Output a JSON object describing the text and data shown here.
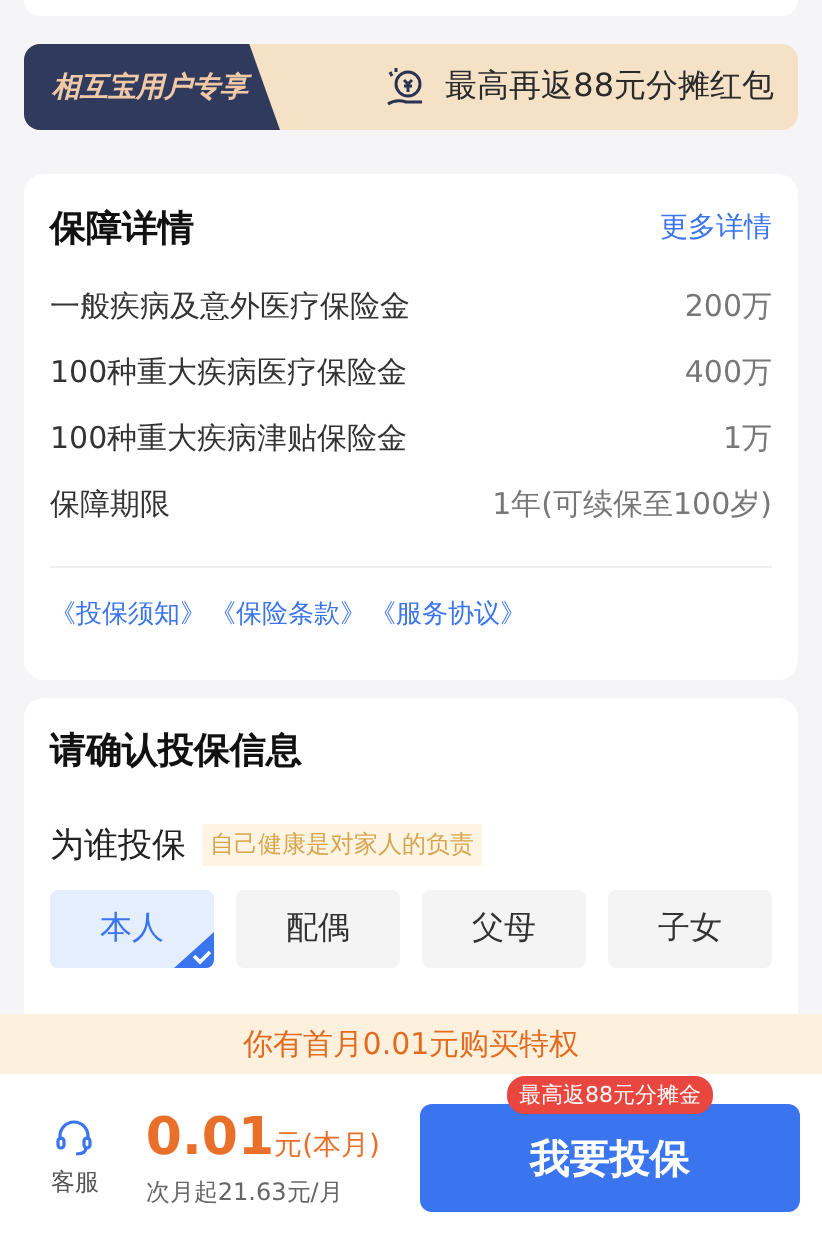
{
  "banner": {
    "tag": "相互宝用户专享",
    "text": "最高再返88元分摊红包"
  },
  "coverage": {
    "title": "保障详情",
    "more": "更多详情",
    "rows": [
      {
        "label": "一般疾病及意外医疗保险金",
        "value": "200万"
      },
      {
        "label": "100种重大疾病医疗保险金",
        "value": "400万"
      },
      {
        "label": "100种重大疾病津贴保险金",
        "value": "1万"
      },
      {
        "label": "保障期限",
        "value": "1年(可续保至100岁)"
      }
    ],
    "links": [
      "《投保须知》",
      "《保险条款》",
      "《服务协议》"
    ]
  },
  "insured": {
    "title": "请确认投保信息",
    "question": "为谁投保",
    "hint": "自己健康是对家人的负责",
    "options": [
      {
        "label": "本人",
        "selected": true
      },
      {
        "label": "配偶",
        "selected": false
      },
      {
        "label": "父母",
        "selected": false
      },
      {
        "label": "子女",
        "selected": false
      }
    ]
  },
  "promo": "你有首月0.01元购买特权",
  "bottom_bar": {
    "service": "客服",
    "price": "0.01",
    "price_unit": "元(本月)",
    "next_price": "次月起21.63元/月",
    "button": "我要投保",
    "badge": "最高返88元分摊金"
  }
}
